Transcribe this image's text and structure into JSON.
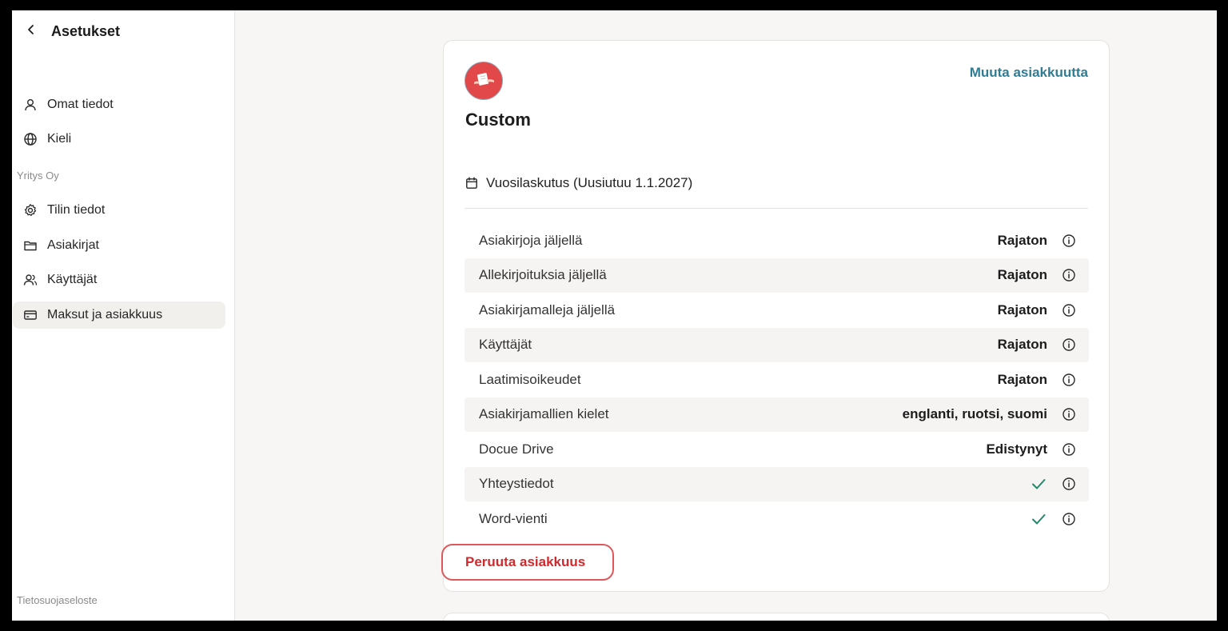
{
  "sidebar": {
    "title": "Asetukset",
    "personal_items": [
      {
        "label": "Omat tiedot",
        "icon": "user-icon"
      },
      {
        "label": "Kieli",
        "icon": "globe-icon"
      }
    ],
    "company_label": "Yritys Oy",
    "company_items": [
      {
        "label": "Tilin tiedot",
        "icon": "gear-icon"
      },
      {
        "label": "Asiakirjat",
        "icon": "folder-icon"
      },
      {
        "label": "Käyttäjät",
        "icon": "users-icon"
      },
      {
        "label": "Maksut ja asiakkuus",
        "icon": "credit-card-icon",
        "active": true
      }
    ],
    "footer_link": "Tietosuojaseloste"
  },
  "plan": {
    "name": "Custom",
    "change_label": "Muuta asiakkuutta",
    "billing_text": "Vuosilaskutus (Uusiutuu 1.1.2027)",
    "features": [
      {
        "label": "Asiakirjoja jäljellä",
        "value": "Rajaton"
      },
      {
        "label": "Allekirjoituksia jäljellä",
        "value": "Rajaton"
      },
      {
        "label": "Asiakirjamalleja jäljellä",
        "value": "Rajaton"
      },
      {
        "label": "Käyttäjät",
        "value": "Rajaton"
      },
      {
        "label": "Laatimisoikeudet",
        "value": "Rajaton"
      },
      {
        "label": "Asiakirjamallien kielet",
        "value": "englanti, ruotsi, suomi"
      },
      {
        "label": "Docue Drive",
        "value": "Edistynyt"
      },
      {
        "label": "Yhteystiedot",
        "value": "check-icon"
      },
      {
        "label": "Word-vienti",
        "value": "check-icon"
      }
    ],
    "cancel_label": "Peruuta asiakkuus"
  },
  "colors": {
    "accent_link": "#2f7c95",
    "cancel_red": "#d2292d",
    "check_green": "#1f8a6a",
    "avatar_red": "#e2484a"
  }
}
